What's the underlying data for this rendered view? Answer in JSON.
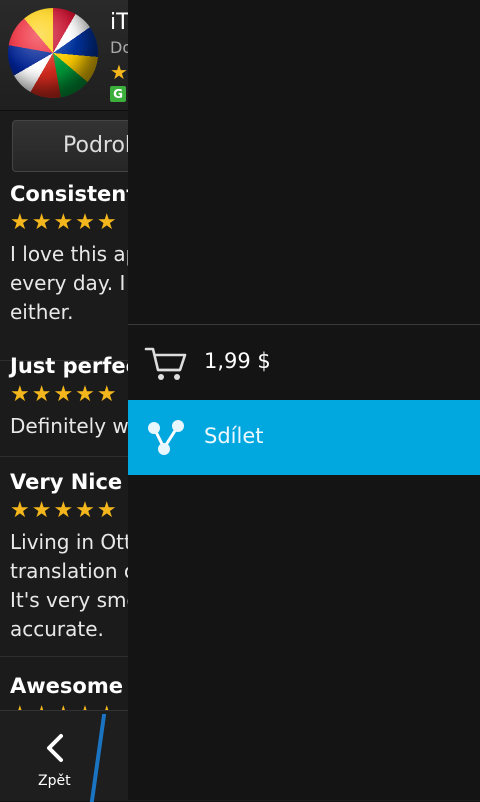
{
  "app": {
    "title_partial": "iT",
    "developer_partial": "Do",
    "rating_star": "★",
    "badge": "G"
  },
  "tabs": {
    "details_partial": "Podrob"
  },
  "reviews": [
    {
      "title": "Consistent",
      "stars": "★★★★★",
      "text": "I love this ap\nevery day. I\neither."
    },
    {
      "title": "Just perfec",
      "stars": "★★★★★",
      "text": "Definitely w"
    },
    {
      "title": "Very Nice",
      "stars": "★★★★★",
      "text": "Living in Ott\ntranslation c\nIt's very smo\naccurate."
    },
    {
      "title": "Awesome",
      "stars": "★★★★★",
      "text": ""
    }
  ],
  "bottom_bar": {
    "back_label": "Zpět",
    "back_icon": "chevron-left-icon"
  },
  "panel": {
    "actions": [
      {
        "label": "1,99 $",
        "icon": "cart-icon"
      },
      {
        "label": "Sdílet",
        "icon": "share-icon"
      }
    ],
    "selected_color": "#00a8df"
  }
}
